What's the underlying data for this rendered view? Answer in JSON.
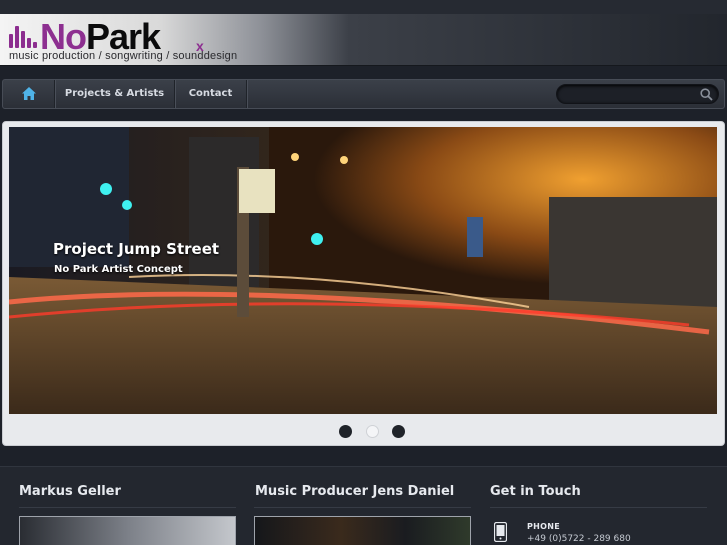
{
  "brand": {
    "logo_prefix": "No",
    "logo_suffix": "Park",
    "logo_mark": "x",
    "tagline": "music production / songwriting / sounddesign",
    "accent_color": "#8d2f90"
  },
  "nav": {
    "home_icon": "home-icon",
    "items": [
      {
        "label": "Projects & Artists"
      },
      {
        "label": "Contact"
      }
    ],
    "search_placeholder": "",
    "search_icon": "search-icon"
  },
  "slider": {
    "title": "Project Jump Street",
    "subtitle": "No Park Artist Concept",
    "slide_count": 3,
    "active_slide": 2
  },
  "columns": [
    {
      "title": "Markus Geller"
    },
    {
      "title": "Music Producer Jens Daniel"
    },
    {
      "title": "Get in Touch"
    }
  ],
  "contact": {
    "phone_label": "PHONE",
    "phone_number": "+49 (0)5722 - 289 680",
    "phone_icon": "phone-icon"
  }
}
